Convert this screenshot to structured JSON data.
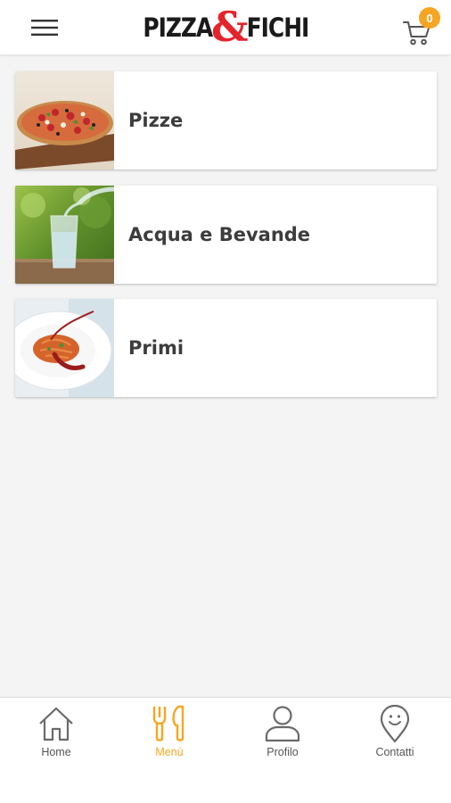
{
  "header": {
    "logo_left": "PIZZA",
    "logo_amp": "&",
    "logo_right": "FICHI",
    "cart_count": "0"
  },
  "categories": [
    {
      "label": "Pizze",
      "icon": "pizza-photo"
    },
    {
      "label": "Acqua e Bevande",
      "icon": "water-glass-photo"
    },
    {
      "label": "Primi",
      "icon": "pasta-plate-photo"
    }
  ],
  "nav": {
    "items": [
      {
        "label": "Home",
        "icon": "home-icon"
      },
      {
        "label": "Menù",
        "icon": "fork-knife-icon"
      },
      {
        "label": "Profilo",
        "icon": "user-icon"
      },
      {
        "label": "Contatti",
        "icon": "location-smile-icon"
      }
    ],
    "active_index": 1
  },
  "colors": {
    "accent": "#f5a623",
    "logo_red": "#e5232b",
    "text": "#3c3c3c",
    "background": "#f4f4f4"
  }
}
